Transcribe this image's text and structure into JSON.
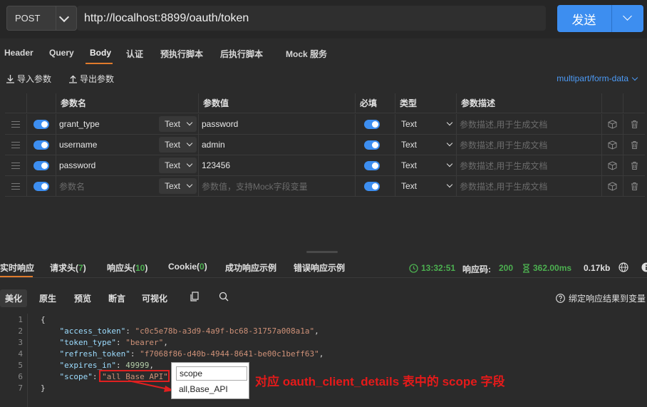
{
  "request": {
    "method": "POST",
    "url": "http://localhost:8899/oauth/token",
    "send_label": "发送"
  },
  "tabs": [
    "Header",
    "Query",
    "Body",
    "认证",
    "预执行脚本",
    "后执行脚本",
    "Mock 服务"
  ],
  "params_actions": {
    "import": "导入参数",
    "export": "导出参数",
    "content_type": "multipart/form-data"
  },
  "params_table": {
    "headers": [
      "参数名",
      "参数值",
      "必填",
      "类型",
      "参数描述"
    ],
    "rows": [
      {
        "name": "grant_type",
        "name_type": "Text",
        "value": "password",
        "type": "Text",
        "desc_placeholder": "参数描述,用于生成文档"
      },
      {
        "name": "username",
        "name_type": "Text",
        "value": "admin",
        "type": "Text",
        "desc_placeholder": "参数描述,用于生成文档"
      },
      {
        "name": "password",
        "name_type": "Text",
        "value": "123456",
        "type": "Text",
        "desc_placeholder": "参数描述,用于生成文档"
      },
      {
        "name_placeholder": "参数名",
        "name_type": "Text",
        "value_placeholder": "参数值，支持Mock字段变量",
        "type": "Text",
        "desc_placeholder": "参数描述,用于生成文档"
      }
    ]
  },
  "response": {
    "tabs": {
      "realtime": "实时响应",
      "req_headers": "请求头(",
      "req_headers_count": "7",
      "resp_headers": "响应头(",
      "resp_headers_count": "10",
      "cookie": "Cookie(",
      "cookie_count": "0",
      "close": ")",
      "success_example": "成功响应示例",
      "error_example": "错误响应示例"
    },
    "time": "13:32:51",
    "status_label": "响应码:",
    "status_code": "200",
    "duration": "362.00ms",
    "size": "0.17kb",
    "view_tabs": [
      "美化",
      "原生",
      "预览",
      "断言",
      "可视化"
    ],
    "bind_label": "绑定响应结果到变量",
    "json_lines": {
      "l1": "{",
      "access_token_key": "\"access_token\"",
      "access_token_val": "\"c0c5e78b-a3d9-4a9f-bc68-31757a008a1a\"",
      "token_type_key": "\"token_type\"",
      "token_type_val": "\"bearer\"",
      "refresh_token_key": "\"refresh_token\"",
      "refresh_token_val": "\"f7068f86-d40b-4944-8641-be00c1beff63\"",
      "expires_in_key": "\"expires_in\"",
      "expires_in_val": "49999",
      "scope_key": "\"scope\"",
      "scope_val": "\"all Base_API\"",
      "l7": "}"
    },
    "line_numbers": [
      "1",
      "2",
      "3",
      "4",
      "5",
      "6",
      "7"
    ]
  },
  "popup": {
    "header": "scope",
    "value": "all,Base_API"
  },
  "annotation": "对应 oauth_client_details 表中的 scope 字段",
  "colors": {
    "accent": "#3d8ef0",
    "active_tab": "#e07b2c",
    "success": "#4caf50",
    "annotation": "#e51a1a"
  }
}
